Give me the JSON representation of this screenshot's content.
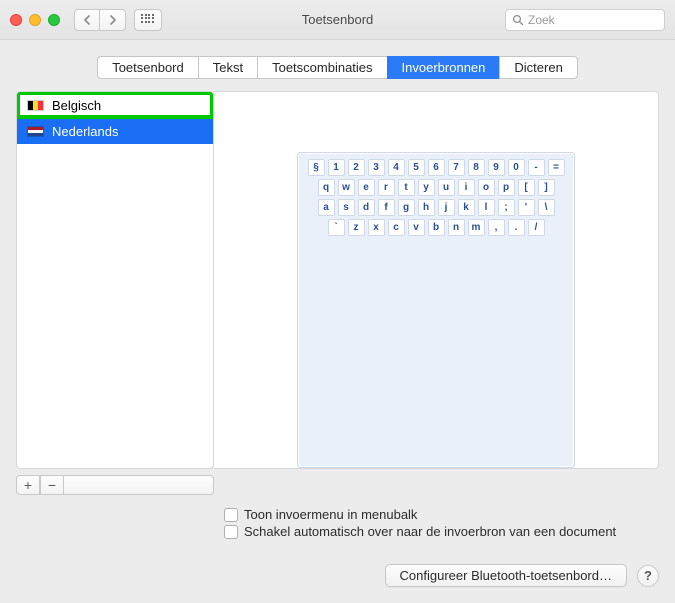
{
  "window": {
    "title": "Toetsenbord"
  },
  "search": {
    "placeholder": "Zoek"
  },
  "tabs": {
    "items": [
      "Toetsenbord",
      "Tekst",
      "Toetscombinaties",
      "Invoerbronnen",
      "Dicteren"
    ],
    "active_index": 3
  },
  "sources": {
    "items": [
      {
        "label": "Belgisch",
        "flag": "be",
        "highlighted": true
      },
      {
        "label": "Nederlands",
        "flag": "nl",
        "selected": true
      }
    ]
  },
  "keyboard_layout": {
    "rows": [
      [
        "§",
        "1",
        "2",
        "3",
        "4",
        "5",
        "6",
        "7",
        "8",
        "9",
        "0",
        "-",
        "="
      ],
      [
        "q",
        "w",
        "e",
        "r",
        "t",
        "y",
        "u",
        "i",
        "o",
        "p",
        "[",
        "]"
      ],
      [
        "a",
        "s",
        "d",
        "f",
        "g",
        "h",
        "j",
        "k",
        "l",
        ";",
        "'",
        "\\"
      ],
      [
        "`",
        "z",
        "x",
        "c",
        "v",
        "b",
        "n",
        "m",
        ",",
        ".",
        "/"
      ]
    ]
  },
  "options": {
    "show_in_menubar": "Toon invoermenu in menubalk",
    "auto_switch": "Schakel automatisch over naar de invoerbron van een document"
  },
  "footer": {
    "configure_bt": "Configureer Bluetooth-toetsenbord…",
    "help": "?"
  },
  "buttons": {
    "add": "+",
    "remove": "−"
  }
}
